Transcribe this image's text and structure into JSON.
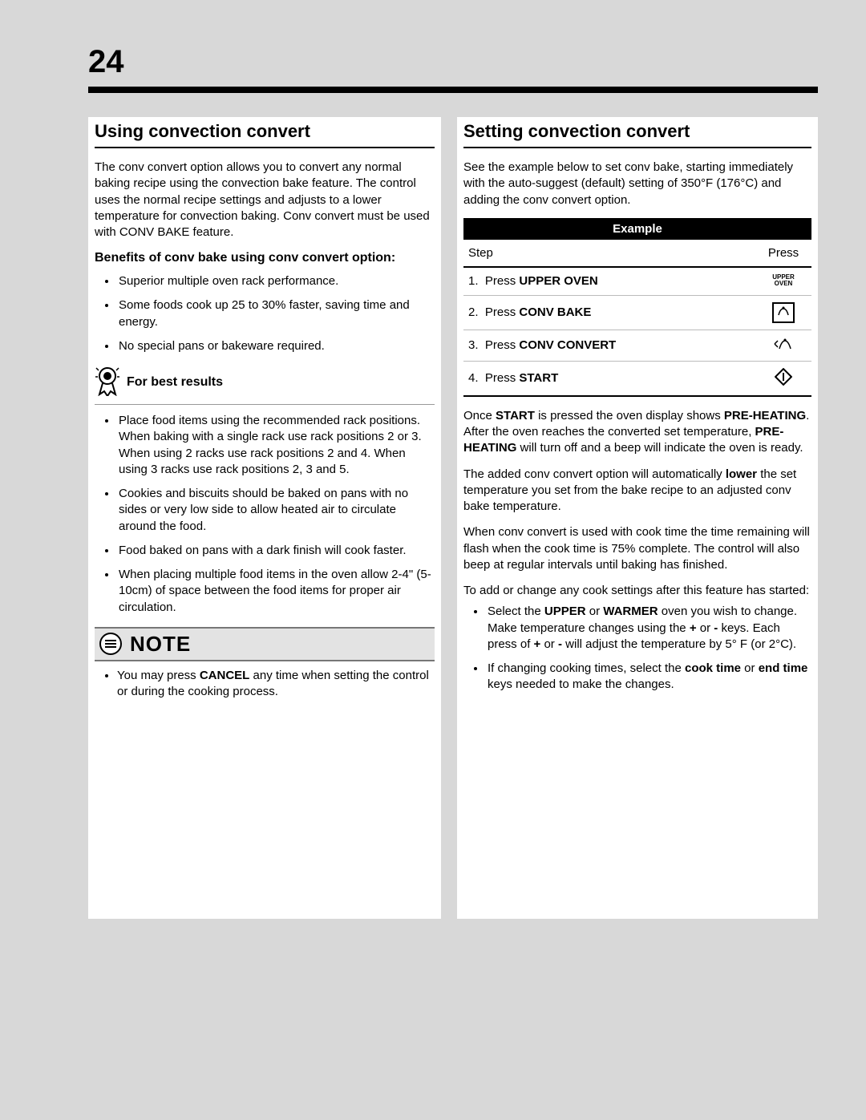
{
  "page_number": "24",
  "left": {
    "title": "Using convection convert",
    "intro": "The conv convert option allows you to convert any normal baking recipe using the convection bake feature. The control uses the normal recipe settings and adjusts to a lower temperature for convection baking. Conv convert must be used with CONV BAKE feature.",
    "benefits_heading": "Benefits of conv bake using conv convert option:",
    "benefits": [
      "Superior multiple oven rack performance.",
      "Some foods cook up 25 to 30% faster, saving time and energy.",
      "No special pans or bakeware required."
    ],
    "best_results_heading": "For best results",
    "best_results": [
      "Place food items using the recommended rack positions. When baking with a single rack use rack positions 2 or 3. When using 2 racks use rack positions 2 and 4. When using 3 racks use rack positions 2, 3 and 5.",
      "Cookies and biscuits should be baked on pans with no sides or very low side to allow heated air to circulate around the food.",
      "Food baked on pans with a dark finish will cook faster.",
      "When placing multiple food items in the oven allow 2-4\" (5-10cm) of space between the food items for proper air circulation."
    ],
    "note_title": "NOTE",
    "note_items_pre": "You may press ",
    "note_cancel": "CANCEL",
    "note_items_post": " any time when setting the control or during the cooking process."
  },
  "right": {
    "title": "Setting convection convert",
    "intro": "See the example below to set conv bake, starting immediately with the auto-suggest (default) setting of 350°F (176°C) and adding the conv convert option.",
    "example_header": "Example",
    "col_step": "Step",
    "col_press": "Press",
    "steps": [
      {
        "num": "1.",
        "pre": "Press ",
        "bold": "UPPER OVEN",
        "icon": "upper-oven"
      },
      {
        "num": "2.",
        "pre": "Press ",
        "bold": "CONV BAKE",
        "icon": "conv-bake"
      },
      {
        "num": "3.",
        "pre": "Press ",
        "bold": "CONV CONVERT",
        "icon": "conv-convert"
      },
      {
        "num": "4.",
        "pre": "Press ",
        "bold": "START",
        "icon": "start"
      }
    ],
    "para1_a": "Once ",
    "para1_b": "START",
    "para1_c": " is pressed the oven display shows ",
    "para1_d": "PRE-HEATING",
    "para1_e": ". After the oven reaches the converted set temperature, ",
    "para1_f": "PRE-HEATING",
    "para1_g": " will turn off and a beep will indicate the oven is ready.",
    "para2_a": "The added conv convert option will automatically ",
    "para2_b": "lower",
    "para2_c": " the set temperature you set from the bake recipe to an adjusted conv bake temperature.",
    "para3": "When conv convert is used with cook time the time remaining will flash when the cook time is 75% complete. The control will also beep at regular intervals until baking has finished.",
    "para4": "To add or change any cook settings after this feature has started:",
    "bullets2_a1": "Select the ",
    "bullets2_a2": "UPPER",
    "bullets2_a3": " or ",
    "bullets2_a4": "WARMER",
    "bullets2_a5": " oven you wish to change. Make temperature changes using the ",
    "bullets2_a6": "+",
    "bullets2_a7": " or ",
    "bullets2_a8": "-",
    "bullets2_a9": " keys. Each press of ",
    "bullets2_a10": "+",
    "bullets2_a11": " or ",
    "bullets2_a12": "-",
    "bullets2_a13": " will adjust the temperature by 5° F (or 2°C).",
    "bullets2_b1": "If changing cooking times, select the ",
    "bullets2_b2": "cook time",
    "bullets2_b3": " or ",
    "bullets2_b4": "end time",
    "bullets2_b5": " keys needed to make the changes."
  }
}
